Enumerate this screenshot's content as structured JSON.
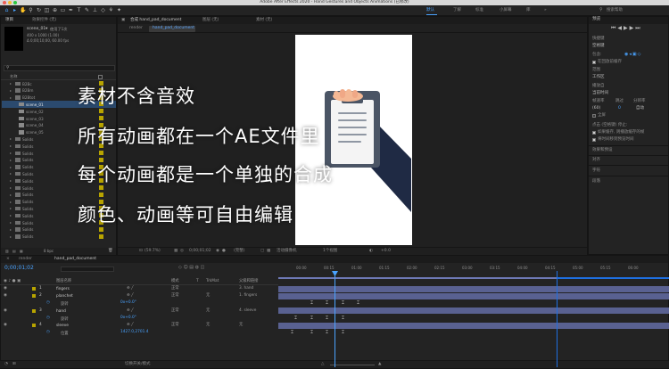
{
  "app": {
    "title": "Adobe After Effects 2020 - Hand Gestures and Objects Animations (已修改)"
  },
  "toolbar": {
    "workspace_tabs": [
      "默认",
      "了解",
      "标准",
      "小屏幕",
      "库"
    ],
    "active_workspace": "默认",
    "search_placeholder": "搜索帮助"
  },
  "project_panel": {
    "tabs": [
      "项目",
      "效果控件 (无)"
    ],
    "selected_name": "scene_01▾",
    "selected_usage": "使用了1次",
    "selected_info_1": "400 x 1000 (1.00)",
    "selected_info_2": "Δ 0;00;10;00, 60.00 fps",
    "column_name": "名称",
    "footer": "8 bpc",
    "items": [
      {
        "name": "B2Bc",
        "type": "folder",
        "depth": 0
      },
      {
        "name": "B2Bm",
        "type": "folder",
        "depth": 0
      },
      {
        "name": "B2Btot",
        "type": "folder",
        "depth": 0
      },
      {
        "name": "scene_01",
        "type": "comp",
        "depth": 1,
        "selected": true
      },
      {
        "name": "scene_02",
        "type": "comp",
        "depth": 1
      },
      {
        "name": "scene_03",
        "type": "comp",
        "depth": 1
      },
      {
        "name": "scene_04",
        "type": "comp",
        "depth": 1
      },
      {
        "name": "scene_05",
        "type": "comp",
        "depth": 1
      },
      {
        "name": "Solids",
        "type": "folder",
        "depth": 0
      },
      {
        "name": "Solids",
        "type": "folder",
        "depth": 0
      },
      {
        "name": "Solids",
        "type": "folder",
        "depth": 0
      },
      {
        "name": "Solids",
        "type": "folder",
        "depth": 0
      },
      {
        "name": "Solids",
        "type": "folder",
        "depth": 0
      },
      {
        "name": "Solids",
        "type": "folder",
        "depth": 0
      },
      {
        "name": "Solids",
        "type": "folder",
        "depth": 0
      },
      {
        "name": "Solids",
        "type": "folder",
        "depth": 0
      },
      {
        "name": "Solids",
        "type": "folder",
        "depth": 0
      },
      {
        "name": "Solids",
        "type": "folder",
        "depth": 0
      },
      {
        "name": "Solids",
        "type": "folder",
        "depth": 0
      },
      {
        "name": "Solids",
        "type": "folder",
        "depth": 0
      },
      {
        "name": "Solids",
        "type": "folder",
        "depth": 0
      },
      {
        "name": "Solids",
        "type": "folder",
        "depth": 0
      },
      {
        "name": "Solids",
        "type": "folder",
        "depth": 0
      }
    ]
  },
  "viewer": {
    "comp_tab": "合成 hand_pad_document",
    "layer_tab": "图层 (无)",
    "footage_tab": "素材 (无)",
    "breadcrumbs": [
      "render",
      "hand_pad_document"
    ],
    "zoom": "(59.7%)",
    "timecode": "0;00;01;02",
    "quality": "(完整)",
    "camera": "活动摄像机",
    "views": "1个视图",
    "offset": "+0.0"
  },
  "overlay": {
    "lines": [
      "素材不含音效",
      "所有动画都在一个AE文件里",
      "每个动画都是一个单独的合成",
      "颜色、动画等可自由编辑"
    ]
  },
  "right_panel": {
    "preview_title": "预览",
    "shortcut_label": "快捷键",
    "shortcut_value": "空格键",
    "include_label": "包含:",
    "cache_check": "在回放前缓存",
    "range_label": "范围",
    "range_value": "工作区",
    "play_from_label": "播放自",
    "play_from_value": "当前时间",
    "frame_rate_label": "帧速率",
    "skip_label": "跳过",
    "resolution_label": "分辨率",
    "frame_rate_value": "(60)",
    "skip_value": "0",
    "resolution_value": "自动",
    "fullscreen_check": "全屏",
    "stop_label": "点击 (空格键) 停止:",
    "cache_stop_check": "如果缓存, 则播放缓存的帧",
    "move_time_check": "将时间移到预览时间",
    "sections": [
      "效果和预设",
      "对齐",
      "字符",
      "段落"
    ]
  },
  "timeline": {
    "tabs": [
      "render",
      "hand_pad_document"
    ],
    "timecode": "0;00;01;02",
    "columns": [
      "图层名称",
      "模式",
      "T",
      "TrkMat",
      "父级和链接"
    ],
    "ruler": [
      "00:00",
      "00:15",
      "01:00",
      "01:15",
      "02:00",
      "02:15",
      "03:00",
      "03:15",
      "04:00",
      "04:15",
      "05:00",
      "05:15",
      "06:00"
    ],
    "layers": [
      {
        "num": "1",
        "name": "fingers",
        "mode": "正常",
        "trkmat": "",
        "parent": "3. hand",
        "color": "#b8a400"
      },
      {
        "num": "2",
        "name": "planchet",
        "mode": "正常",
        "trkmat": "无",
        "parent": "1. fingers",
        "color": "#b8a400"
      },
      {
        "num": "",
        "name": "旋转",
        "prop": true,
        "value": "0x+0.0°"
      },
      {
        "num": "3",
        "name": "hand",
        "mode": "正常",
        "trkmat": "无",
        "parent": "4. sleeve",
        "color": "#b8a400"
      },
      {
        "num": "",
        "name": "旋转",
        "prop": true,
        "value": "0x+0.0°"
      },
      {
        "num": "4",
        "name": "sleeve",
        "mode": "正常",
        "trkmat": "无",
        "parent": "无",
        "color": "#b8a400"
      },
      {
        "num": "",
        "name": "位置",
        "prop": true,
        "value": "1427.0,2701.4"
      }
    ],
    "keyframe_glyph": "⌶",
    "footer": "切换开关/模式"
  }
}
